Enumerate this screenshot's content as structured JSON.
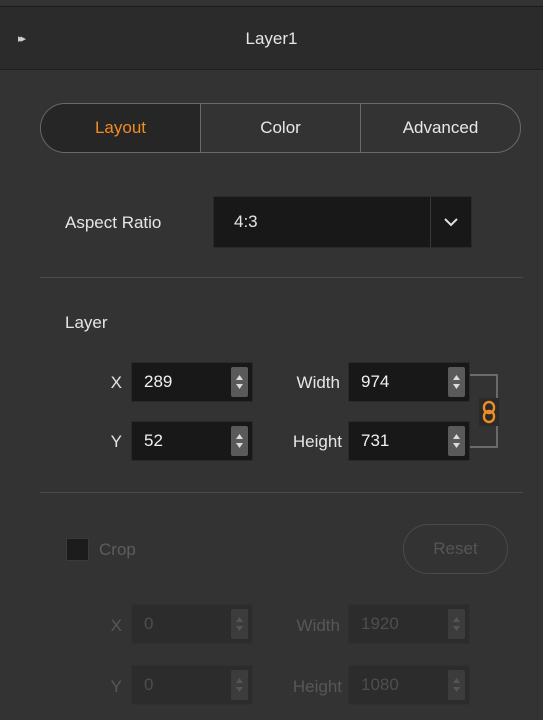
{
  "header": {
    "title": "Layer1",
    "collapse_glyph": "▸▸"
  },
  "tabs": [
    {
      "label": "Layout",
      "active": true
    },
    {
      "label": "Color",
      "active": false
    },
    {
      "label": "Advanced",
      "active": false
    }
  ],
  "aspect_ratio": {
    "label": "Aspect Ratio",
    "value": "4:3"
  },
  "layer": {
    "section_label": "Layer",
    "x_label": "X",
    "x_value": "289",
    "y_label": "Y",
    "y_value": "52",
    "width_label": "Width",
    "width_value": "974",
    "height_label": "Height",
    "height_value": "731"
  },
  "crop": {
    "label": "Crop",
    "checked": false,
    "reset_label": "Reset",
    "x_label": "X",
    "x_value": "0",
    "y_label": "Y",
    "y_value": "0",
    "width_label": "Width",
    "width_value": "1920",
    "height_label": "Height",
    "height_value": "1080"
  },
  "colors": {
    "accent": "#f08c24",
    "panel": "#333333",
    "field": "#181818"
  },
  "icons": {
    "collapse": "double-chevron-right-icon",
    "dropdown": "chevron-down-icon",
    "link": "chain-link-icon",
    "spinner": "up-down-arrows-icon"
  }
}
